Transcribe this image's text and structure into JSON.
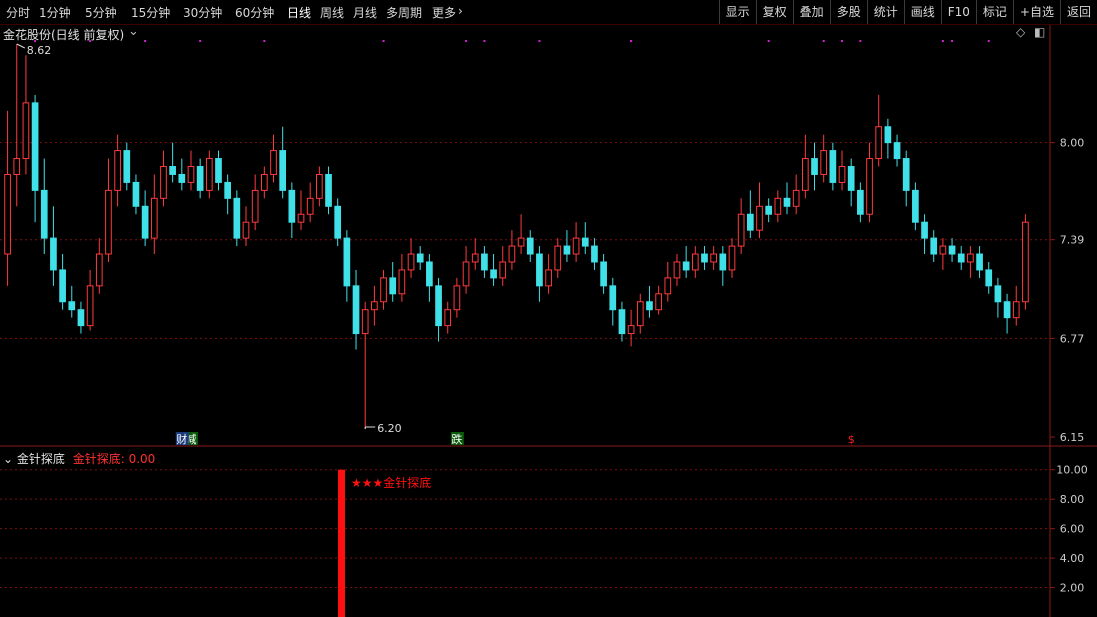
{
  "toolbar": {
    "periods": [
      {
        "label": "分时"
      },
      {
        "label": "1分钟"
      },
      {
        "label": "5分钟"
      },
      {
        "label": "15分钟"
      },
      {
        "label": "30分钟"
      },
      {
        "label": "60分钟"
      },
      {
        "label": "日线"
      },
      {
        "label": "周线"
      },
      {
        "label": "月线"
      },
      {
        "label": "多周期"
      },
      {
        "label": "更多"
      }
    ],
    "more_arrow": "›",
    "tools": [
      {
        "label": "显示"
      },
      {
        "label": "复权"
      },
      {
        "label": "叠加"
      },
      {
        "label": "多股"
      },
      {
        "label": "统计"
      },
      {
        "label": "画线"
      },
      {
        "label": "F10"
      },
      {
        "label": "标记"
      },
      {
        "label": "+自选"
      },
      {
        "label": "返回"
      }
    ]
  },
  "main_panel": {
    "title": "金花股份(日线 前复权)",
    "high_label": "8.62",
    "low_label": "6.20",
    "y_ticks": [
      {
        "label": "8.00",
        "value": 8.0
      },
      {
        "label": "7.39",
        "value": 7.39
      },
      {
        "label": "6.77",
        "value": 6.77
      },
      {
        "label": "6.15",
        "value": 6.15
      }
    ],
    "markers": [
      {
        "label": "减",
        "color": "#2a9a2a",
        "index": 20
      },
      {
        "label": "跌",
        "color": "#2a9a2a",
        "index": 49
      },
      {
        "label": "$",
        "color": "#ff2020",
        "index": 92
      },
      {
        "label": "财",
        "color": "#4a7ad8",
        "index": 131
      }
    ],
    "colors": {
      "up": "#ff3b3b",
      "down": "#40e0e8",
      "grid": "#7a1010",
      "magenta": "#d020d0"
    }
  },
  "indicator_panel": {
    "name": "金针探底",
    "value_label": "金针探底: 0.00",
    "signal_text": "★★★金针探底",
    "y_ticks": [
      {
        "label": "10.00",
        "value": 10
      },
      {
        "label": "8.00",
        "value": 8
      },
      {
        "label": "6.00",
        "value": 6
      },
      {
        "label": "4.00",
        "value": 4
      },
      {
        "label": "2.00",
        "value": 2
      }
    ],
    "signal_color": "#ff1010"
  },
  "chart_data": {
    "type": "candlestick",
    "ylim": [
      6.15,
      8.62
    ],
    "signal": {
      "index": 50,
      "value": 10
    },
    "candles": [
      [
        7.3,
        7.8,
        8.2,
        7.1
      ],
      [
        7.8,
        7.9,
        8.62,
        7.6
      ],
      [
        7.9,
        8.25,
        8.55,
        7.8
      ],
      [
        8.25,
        7.7,
        8.3,
        7.5
      ],
      [
        7.7,
        7.4,
        7.9,
        7.3
      ],
      [
        7.4,
        7.2,
        7.6,
        7.1
      ],
      [
        7.2,
        7.0,
        7.3,
        6.95
      ],
      [
        7.0,
        6.95,
        7.1,
        6.9
      ],
      [
        6.95,
        6.85,
        7.0,
        6.8
      ],
      [
        6.85,
        7.1,
        7.2,
        6.82
      ],
      [
        7.1,
        7.3,
        7.4,
        7.05
      ],
      [
        7.3,
        7.7,
        7.9,
        7.25
      ],
      [
        7.7,
        7.95,
        8.05,
        7.6
      ],
      [
        7.95,
        7.75,
        8.0,
        7.7
      ],
      [
        7.75,
        7.6,
        7.8,
        7.55
      ],
      [
        7.6,
        7.4,
        7.7,
        7.35
      ],
      [
        7.4,
        7.65,
        7.8,
        7.3
      ],
      [
        7.65,
        7.85,
        7.95,
        7.6
      ],
      [
        7.85,
        7.8,
        8.0,
        7.75
      ],
      [
        7.8,
        7.75,
        7.9,
        7.7
      ],
      [
        7.75,
        7.85,
        7.95,
        7.7
      ],
      [
        7.85,
        7.7,
        7.9,
        7.65
      ],
      [
        7.7,
        7.9,
        7.95,
        7.65
      ],
      [
        7.9,
        7.75,
        7.95,
        7.7
      ],
      [
        7.75,
        7.65,
        7.8,
        7.55
      ],
      [
        7.65,
        7.4,
        7.7,
        7.35
      ],
      [
        7.4,
        7.5,
        7.6,
        7.35
      ],
      [
        7.5,
        7.7,
        7.8,
        7.45
      ],
      [
        7.7,
        7.8,
        7.85,
        7.65
      ],
      [
        7.8,
        7.95,
        8.05,
        7.75
      ],
      [
        7.95,
        7.7,
        8.1,
        7.65
      ],
      [
        7.7,
        7.5,
        7.75,
        7.4
      ],
      [
        7.5,
        7.55,
        7.7,
        7.45
      ],
      [
        7.55,
        7.65,
        7.75,
        7.5
      ],
      [
        7.65,
        7.8,
        7.85,
        7.6
      ],
      [
        7.8,
        7.6,
        7.85,
        7.55
      ],
      [
        7.6,
        7.4,
        7.65,
        7.35
      ],
      [
        7.4,
        7.1,
        7.45,
        7.0
      ],
      [
        7.1,
        6.8,
        7.2,
        6.7
      ],
      [
        6.8,
        6.95,
        7.0,
        6.2
      ],
      [
        6.95,
        7.0,
        7.1,
        6.85
      ],
      [
        7.0,
        7.15,
        7.2,
        6.95
      ],
      [
        7.15,
        7.05,
        7.25,
        7.0
      ],
      [
        7.05,
        7.2,
        7.3,
        7.0
      ],
      [
        7.2,
        7.3,
        7.4,
        7.15
      ],
      [
        7.3,
        7.25,
        7.35,
        7.2
      ],
      [
        7.25,
        7.1,
        7.3,
        7.0
      ],
      [
        7.1,
        6.85,
        7.15,
        6.75
      ],
      [
        6.85,
        6.95,
        7.0,
        6.8
      ],
      [
        6.95,
        7.1,
        7.15,
        6.9
      ],
      [
        7.1,
        7.25,
        7.35,
        7.05
      ],
      [
        7.25,
        7.3,
        7.4,
        7.2
      ],
      [
        7.3,
        7.2,
        7.35,
        7.15
      ],
      [
        7.2,
        7.15,
        7.3,
        7.1
      ],
      [
        7.15,
        7.25,
        7.35,
        7.1
      ],
      [
        7.25,
        7.35,
        7.45,
        7.2
      ],
      [
        7.35,
        7.4,
        7.55,
        7.3
      ],
      [
        7.4,
        7.3,
        7.45,
        7.25
      ],
      [
        7.3,
        7.1,
        7.35,
        7.0
      ],
      [
        7.1,
        7.2,
        7.3,
        7.05
      ],
      [
        7.2,
        7.35,
        7.4,
        7.15
      ],
      [
        7.35,
        7.3,
        7.45,
        7.25
      ],
      [
        7.3,
        7.4,
        7.5,
        7.25
      ],
      [
        7.4,
        7.35,
        7.5,
        7.3
      ],
      [
        7.35,
        7.25,
        7.4,
        7.2
      ],
      [
        7.25,
        7.1,
        7.3,
        7.05
      ],
      [
        7.1,
        6.95,
        7.15,
        6.85
      ],
      [
        6.95,
        6.8,
        7.0,
        6.75
      ],
      [
        6.8,
        6.85,
        6.95,
        6.72
      ],
      [
        6.85,
        7.0,
        7.05,
        6.8
      ],
      [
        7.0,
        6.95,
        7.1,
        6.9
      ],
      [
        6.95,
        7.05,
        7.1,
        6.92
      ],
      [
        7.05,
        7.15,
        7.25,
        7.0
      ],
      [
        7.15,
        7.25,
        7.3,
        7.1
      ],
      [
        7.25,
        7.2,
        7.35,
        7.15
      ],
      [
        7.2,
        7.3,
        7.35,
        7.15
      ],
      [
        7.3,
        7.25,
        7.35,
        7.2
      ],
      [
        7.25,
        7.3,
        7.35,
        7.2
      ],
      [
        7.3,
        7.2,
        7.35,
        7.1
      ],
      [
        7.2,
        7.35,
        7.4,
        7.15
      ],
      [
        7.35,
        7.55,
        7.65,
        7.3
      ],
      [
        7.55,
        7.45,
        7.7,
        7.4
      ],
      [
        7.45,
        7.6,
        7.75,
        7.4
      ],
      [
        7.6,
        7.55,
        7.65,
        7.5
      ],
      [
        7.55,
        7.65,
        7.7,
        7.5
      ],
      [
        7.65,
        7.6,
        7.75,
        7.55
      ],
      [
        7.6,
        7.7,
        7.8,
        7.55
      ],
      [
        7.7,
        7.9,
        8.05,
        7.65
      ],
      [
        7.9,
        7.8,
        8.0,
        7.7
      ],
      [
        7.8,
        7.95,
        8.05,
        7.75
      ],
      [
        7.95,
        7.75,
        8.0,
        7.7
      ],
      [
        7.75,
        7.85,
        7.95,
        7.7
      ],
      [
        7.85,
        7.7,
        7.9,
        7.6
      ],
      [
        7.7,
        7.55,
        7.75,
        7.5
      ],
      [
        7.55,
        7.9,
        8.0,
        7.5
      ],
      [
        7.9,
        8.1,
        8.3,
        7.85
      ],
      [
        8.1,
        8.0,
        8.15,
        7.9
      ],
      [
        8.0,
        7.9,
        8.05,
        7.85
      ],
      [
        7.9,
        7.7,
        7.95,
        7.6
      ],
      [
        7.7,
        7.5,
        7.75,
        7.45
      ],
      [
        7.5,
        7.4,
        7.55,
        7.3
      ],
      [
        7.4,
        7.3,
        7.45,
        7.25
      ],
      [
        7.3,
        7.35,
        7.4,
        7.2
      ],
      [
        7.35,
        7.3,
        7.4,
        7.25
      ],
      [
        7.3,
        7.25,
        7.35,
        7.2
      ],
      [
        7.25,
        7.3,
        7.35,
        7.15
      ],
      [
        7.3,
        7.2,
        7.35,
        7.15
      ],
      [
        7.2,
        7.1,
        7.25,
        7.05
      ],
      [
        7.1,
        7.0,
        7.15,
        6.9
      ],
      [
        7.0,
        6.9,
        7.05,
        6.8
      ],
      [
        6.9,
        7.0,
        7.1,
        6.85
      ],
      [
        7.0,
        7.5,
        7.55,
        6.95
      ]
    ]
  }
}
